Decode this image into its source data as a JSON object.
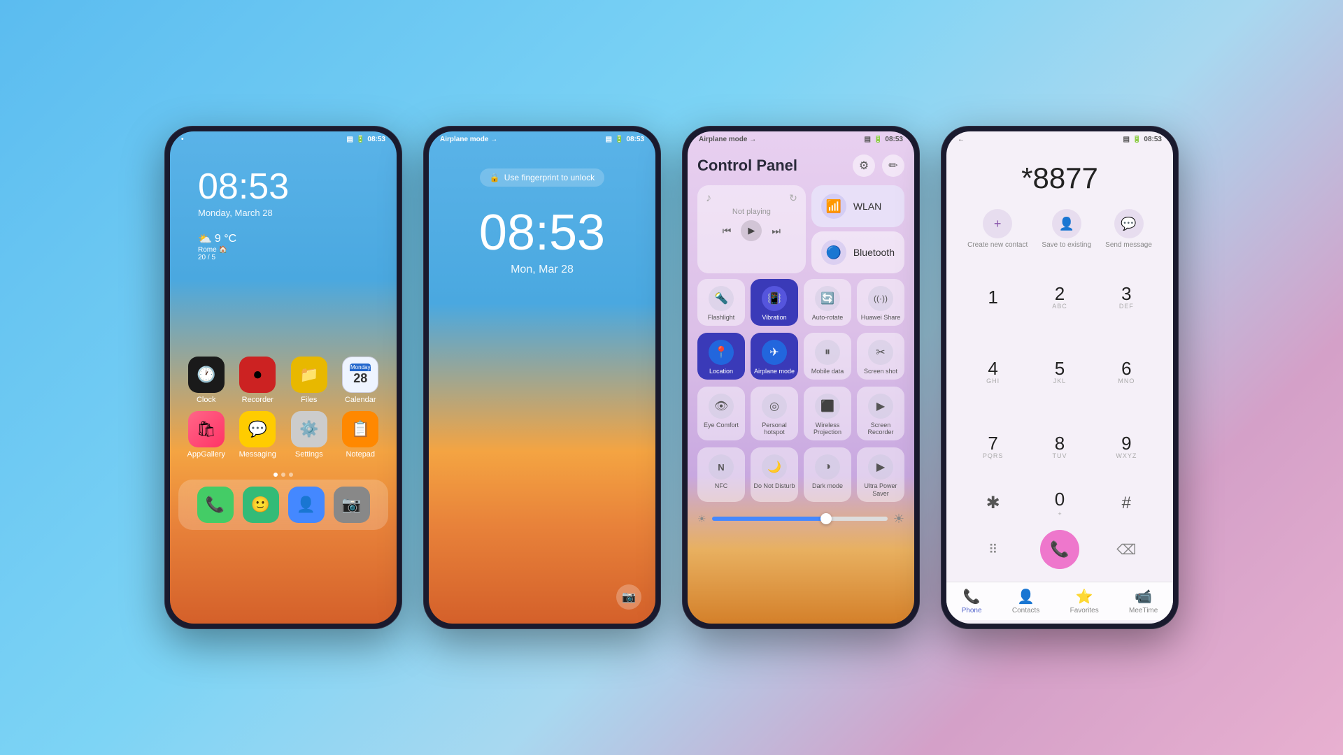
{
  "background": "linear-gradient(135deg, #5bbcf0 0%, #7dd4f5 40%, #a8d8f0 60%, #d4a0c8 80%, #e8b0d0 100%)",
  "phone1": {
    "status_left": "•",
    "status_right": "08:53",
    "time": "08:53",
    "date": "Monday, March 28",
    "weather_temp": "9 °C",
    "weather_city": "Rome 🏠",
    "weather_range": "20 / 5",
    "apps_row1": [
      {
        "label": "Clock",
        "color": "#2a2a2a",
        "icon": "🕐",
        "bg": "#1a1a1a"
      },
      {
        "label": "Recorder",
        "color": "#e03030",
        "icon": "⏺",
        "bg": "#cc2222"
      },
      {
        "label": "Files",
        "color": "#f0c020",
        "icon": "📁",
        "bg": "#e8b800"
      },
      {
        "label": "Calendar",
        "color": "#4488ff",
        "icon": "📅",
        "bg": "#eef4ff"
      }
    ],
    "apps_row2": [
      {
        "label": "AppGallery",
        "color": "#ee4488",
        "icon": "🛒",
        "bg": "#ff3377"
      },
      {
        "label": "Messaging",
        "color": "#ffcc00",
        "icon": "💬",
        "bg": "#ffcc00"
      },
      {
        "label": "Settings",
        "color": "#888888",
        "icon": "⚙️",
        "bg": "#cccccc"
      },
      {
        "label": "Notepad",
        "color": "#ff8800",
        "icon": "📋",
        "bg": "#ff8800"
      }
    ],
    "dock": [
      {
        "label": "Phone",
        "icon": "📞",
        "bg": "#44cc66"
      },
      {
        "label": "Contacts",
        "icon": "🙂",
        "bg": "#44cc88"
      },
      {
        "label": "Contacts2",
        "icon": "👤",
        "bg": "#4488ff"
      },
      {
        "label": "Camera",
        "icon": "📷",
        "bg": "#888888"
      }
    ]
  },
  "phone2": {
    "status_left": "Airplane mode →",
    "status_right": "08:53",
    "fingerprint_hint": "Use fingerprint to unlock",
    "time": "08:53",
    "date": "Mon, Mar 28",
    "camera_icon": "📷"
  },
  "phone3": {
    "status_left": "Airplane mode →",
    "status_right": "08:53",
    "title": "Control Panel",
    "not_playing": "Not playing",
    "wlan_label": "WLAN",
    "bluetooth_label": "Bluetooth",
    "tiles": [
      {
        "label": "Flashlight",
        "icon": "🔦",
        "active": false
      },
      {
        "label": "Vibration",
        "icon": "📳",
        "active": true
      },
      {
        "label": "Auto-rotate",
        "icon": "🔄",
        "active": false
      },
      {
        "label": "Huawei Share",
        "icon": "((·))",
        "active": false
      },
      {
        "label": "Location",
        "icon": "📍",
        "active": true
      },
      {
        "label": "Airplane mode",
        "icon": "✈",
        "active": true
      },
      {
        "label": "Mobile data",
        "icon": "⏸",
        "active": false
      },
      {
        "label": "Screen shot",
        "icon": "✂",
        "active": false
      },
      {
        "label": "Eye Comfort",
        "icon": "👁",
        "active": false
      },
      {
        "label": "Personal hotspot",
        "icon": "◎",
        "active": false
      },
      {
        "label": "Wireless Projection",
        "icon": "⬛",
        "active": false
      },
      {
        "label": "Screen Recorder",
        "icon": "▶",
        "active": false
      },
      {
        "label": "NFC",
        "icon": "N",
        "active": false
      },
      {
        "label": "Do Not Disturb",
        "icon": "🌙",
        "active": false
      },
      {
        "label": "Dark mode",
        "icon": "◑",
        "active": false
      },
      {
        "label": "Ultra Power Saver",
        "icon": "▶",
        "active": false
      }
    ],
    "brightness": 65
  },
  "phone4": {
    "status_left": "←",
    "status_right": "08:53",
    "number": "*8877",
    "actions": [
      {
        "label": "Create new contact",
        "icon": "+"
      },
      {
        "label": "Save to existing",
        "icon": "👤"
      },
      {
        "label": "Send message",
        "icon": "💬"
      }
    ],
    "keys": [
      {
        "num": "1",
        "alpha": ""
      },
      {
        "num": "2",
        "alpha": "ABC"
      },
      {
        "num": "3",
        "alpha": "DEF"
      },
      {
        "num": "4",
        "alpha": "GHI"
      },
      {
        "num": "5",
        "alpha": "JKL"
      },
      {
        "num": "6",
        "alpha": "MNO"
      },
      {
        "num": "7",
        "alpha": "PQRS"
      },
      {
        "num": "8",
        "alpha": "TUV"
      },
      {
        "num": "9",
        "alpha": "WXYZ"
      },
      {
        "num": "*",
        "alpha": ""
      },
      {
        "num": "0",
        "alpha": "+"
      },
      {
        "num": "#",
        "alpha": ""
      }
    ],
    "nav_items": [
      {
        "label": "Phone",
        "icon": "📞",
        "active": true
      },
      {
        "label": "Contacts",
        "icon": "👤",
        "active": false
      },
      {
        "label": "Favorites",
        "icon": "⭐",
        "active": false
      },
      {
        "label": "MeeTime",
        "icon": "📹",
        "active": false
      }
    ]
  }
}
